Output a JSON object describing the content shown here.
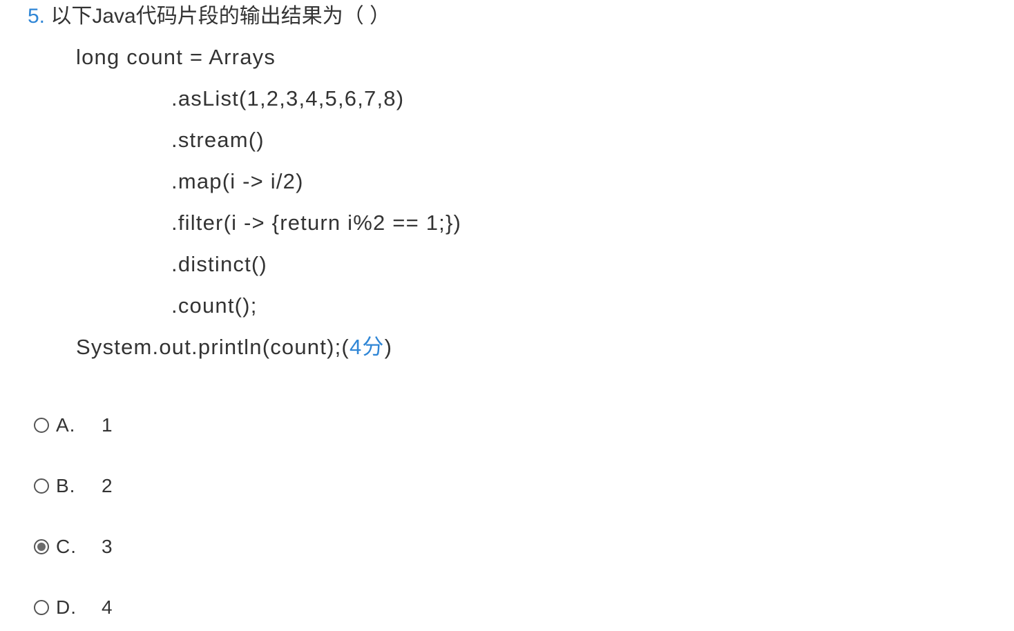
{
  "question": {
    "number": "5.",
    "title": "以下Java代码片段的输出结果为（ ）",
    "code_lines": [
      "long count = Arrays",
      ".asList(1,2,3,4,5,6,7,8)",
      ".stream()",
      ".map(i -> i/2)",
      ".filter(i -> {return i%2 == 1;})",
      ".distinct()",
      ".count();",
      "System.out.println(count);"
    ],
    "score_open": "(",
    "score": "4分",
    "score_close": ")"
  },
  "options": [
    {
      "letter": "A.",
      "text": "1",
      "selected": false
    },
    {
      "letter": "B.",
      "text": "2",
      "selected": false
    },
    {
      "letter": "C.",
      "text": "3",
      "selected": true
    },
    {
      "letter": "D.",
      "text": "4",
      "selected": false
    }
  ]
}
